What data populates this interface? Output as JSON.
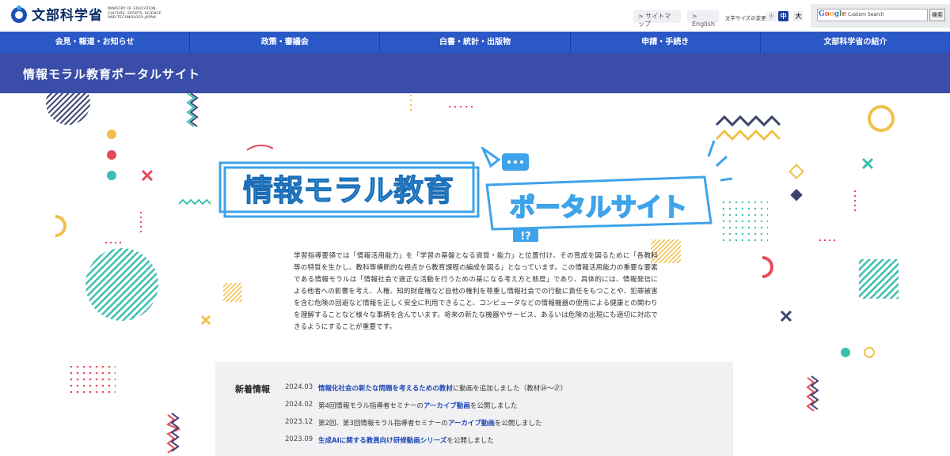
{
  "header": {
    "ministry_name": "文部科学省",
    "ministry_name_en": "MINISTRY OF EDUCATION, CULTURE, SPORTS, SCIENCE AND TECHNOLOGY-JAPAN",
    "sitemap_label": "> サイトマップ",
    "english_label": "> English",
    "font_size_label": "文字サイズの変更",
    "font_size_small": "小",
    "font_size_medium": "中",
    "font_size_large": "大",
    "search_google_label": "Google",
    "search_placeholder": "Custom Search",
    "search_button": "検索"
  },
  "nav": {
    "items": [
      {
        "label": "会見・報道・お知らせ"
      },
      {
        "label": "政策・審議会"
      },
      {
        "label": "白書・統計・出版物"
      },
      {
        "label": "申請・手続き"
      },
      {
        "label": "文部科学省の紹介"
      }
    ]
  },
  "page": {
    "title": "情報モラル教育ポータルサイト"
  },
  "hero": {
    "logo_line1": "情報モラル教育",
    "logo_line2": "ポータルサイト",
    "logo_mark": "!?",
    "intro": "学習指導要領では「情報活用能力」を「学習の基盤となる資質・能力」と位置付け、その育成を図るために「各教科等の特質を生かし、教科等横断的な視点から教育課程の編成を図る」となっています。この情報活用能力の重要な要素である情報モラルは「情報社会で適正な活動を行うための基になる考え方と態度」であり、具体的には、情報発信による他者への影響を考え、人権、知的財産権など自他の権利を尊重し情報社会での行動に責任をもつことや、犯罪被害を含む危険の回避など情報を正しく安全に利用できること、コンピュータなどの情報機器の使用による健康との関わりを理解することなど様々な事柄を含んでいます。将来の新たな機器やサービス、あるいは危険の出現にも適切に対応できるようにすることが重要です。"
  },
  "news": {
    "heading": "新着情報",
    "items": [
      {
        "date": "2024.03",
        "pre": "",
        "link": "情報化社会の新たな問題を考えるための教材",
        "post": "に動画を追加しました（教材㉔〜㉗）"
      },
      {
        "date": "2024.02",
        "pre": "第4回情報モラル指導者セミナーの ",
        "link": "アーカイブ動画",
        "post": " を公開しました"
      },
      {
        "date": "2023.12",
        "pre": "第2回、第3回情報モラル指導者セミナーの ",
        "link": "アーカイブ動画",
        "post": " を公開しました"
      },
      {
        "date": "2023.09",
        "pre": "",
        "link": "生成AIに関する教員向け研修動画シリーズ",
        "post": " を公開しました"
      }
    ]
  },
  "colors": {
    "nav_blue": "#2a58c6",
    "title_band": "#3a4da8",
    "logo_blue": "#3ea3ea",
    "teal": "#3dbfb0",
    "yellow": "#f0c04a",
    "red": "#e54a5a",
    "navy": "#3a4370"
  }
}
